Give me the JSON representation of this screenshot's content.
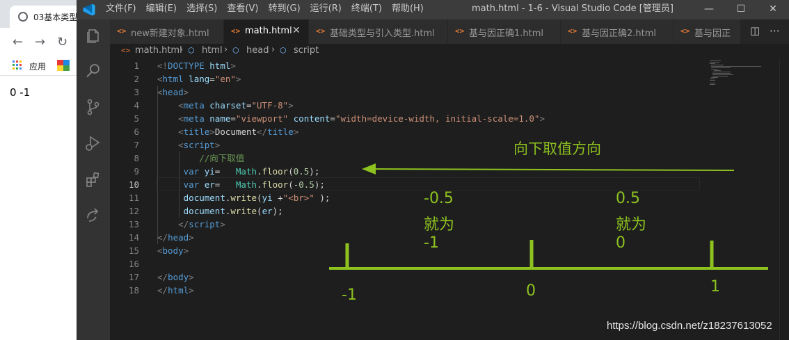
{
  "browser": {
    "tab_title": "03基本类型",
    "nav": {
      "back_icon": "arrow-left-icon",
      "forward_icon": "arrow-right-icon",
      "reload_icon": "reload-icon"
    },
    "bookmarks": {
      "apps_label": "应用"
    },
    "page_text": "0 -1"
  },
  "window": {
    "title": "math.html - 1-6 - Visual Studio Code [管理员]",
    "menu": [
      "文件(F)",
      "编辑(E)",
      "选择(S)",
      "查看(V)",
      "转到(G)",
      "运行(R)",
      "终端(T)",
      "帮助(H)"
    ],
    "controls": {
      "minimize": "—",
      "maximize": "☐",
      "close": "✕"
    }
  },
  "activity_bar": [
    "explorer-icon",
    "search-icon",
    "source-control-icon",
    "run-debug-icon",
    "extensions-icon",
    "remote-icon"
  ],
  "tabs": [
    {
      "label": "new新建对象.html",
      "active": false
    },
    {
      "label": "math.html",
      "active": true
    },
    {
      "label": "基础类型与引入类型.html",
      "active": false
    },
    {
      "label": "基与因正确1.html",
      "active": false
    },
    {
      "label": "基与因正确2.html",
      "active": false
    },
    {
      "label": "基与因正",
      "active": false
    }
  ],
  "tab_icon_text": "<>",
  "breadcrumb": [
    "math.html",
    "html",
    "head",
    "script"
  ],
  "editor": {
    "current_line": 10,
    "lines": [
      "1",
      "2",
      "3",
      "4",
      "5",
      "6",
      "7",
      "8",
      "9",
      "10",
      "11",
      "12",
      "13",
      "14",
      "15",
      "16",
      "17",
      "18"
    ],
    "code": {
      "l1": [
        "<!",
        "DOCTYPE",
        " html",
        ">"
      ],
      "l2": [
        "<",
        "html",
        " lang",
        "=",
        "\"en\"",
        ">"
      ],
      "l3": [
        "<",
        "head",
        ">"
      ],
      "l4": [
        "<",
        "meta",
        " charset",
        "=",
        "\"UTF-8\"",
        ">"
      ],
      "l5": [
        "<",
        "meta",
        " name",
        "=",
        "\"viewport\"",
        " content",
        "=",
        "\"width=device-width, initial-scale=1.0\"",
        ">"
      ],
      "l6": [
        "<",
        "title",
        ">",
        "Document",
        "</",
        "title",
        ">"
      ],
      "l7": [
        "<",
        "script",
        ">"
      ],
      "l8": [
        "//向下取值"
      ],
      "l9": [
        "var",
        " yi",
        "=   ",
        "Math",
        ".",
        "floor",
        "(",
        "0.5",
        ");"
      ],
      "l10": [
        "var",
        " er",
        "=   ",
        "Math",
        ".",
        "floor",
        "(",
        "-0.5",
        ");"
      ],
      "l11": [
        "document",
        ".",
        "write",
        "(",
        "yi",
        " +",
        "\"<br>\"",
        " );"
      ],
      "l12": [
        "document",
        ".",
        "write",
        "(",
        "er",
        ");"
      ],
      "l13": [
        "</",
        "script",
        ">"
      ],
      "l14": [
        "</",
        "head",
        ">"
      ],
      "l15": [
        "<",
        "body",
        ">"
      ],
      "l16": [
        ""
      ],
      "l17": [
        "</",
        "body",
        ">"
      ],
      "l18": [
        "</",
        "html",
        ">"
      ]
    }
  },
  "annotations": {
    "direction_label": "向下取值方向",
    "neg_half": [
      "-0.5",
      "就为",
      "-1"
    ],
    "pos_half": [
      "0.5",
      "就为",
      "0"
    ],
    "axis_ticks": [
      "-1",
      "0",
      "1"
    ],
    "color": "#8dc21f"
  },
  "watermark": "https://blog.csdn.net/z18237613052"
}
